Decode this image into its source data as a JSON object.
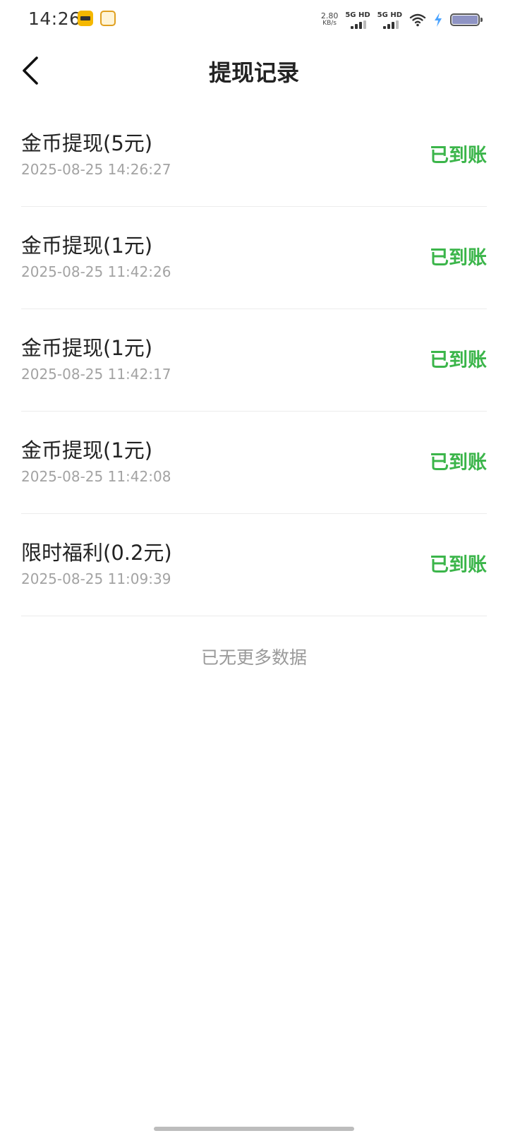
{
  "status_bar": {
    "time": "14:26",
    "net_speed_value": "2.80",
    "net_speed_unit": "KB/s",
    "sim1_label": "5G HD",
    "sim2_label": "5G HD",
    "battery_color": "#8f94c4",
    "charging_color": "#4aa3ff"
  },
  "header": {
    "title": "提现记录",
    "back_icon": "chevron-left-icon"
  },
  "records": [
    {
      "title": "金币提现(5元)",
      "time": "2025-08-25 14:26:27",
      "status": "已到账"
    },
    {
      "title": "金币提现(1元)",
      "time": "2025-08-25 11:42:26",
      "status": "已到账"
    },
    {
      "title": "金币提现(1元)",
      "time": "2025-08-25 11:42:17",
      "status": "已到账"
    },
    {
      "title": "金币提现(1元)",
      "time": "2025-08-25 11:42:08",
      "status": "已到账"
    },
    {
      "title": "限时福利(0.2元)",
      "time": "2025-08-25 11:09:39",
      "status": "已到账"
    }
  ],
  "footer": {
    "no_more_text": "已无更多数据"
  },
  "colors": {
    "status_success": "#3bb54a",
    "secondary_text": "#a3a3a3"
  }
}
